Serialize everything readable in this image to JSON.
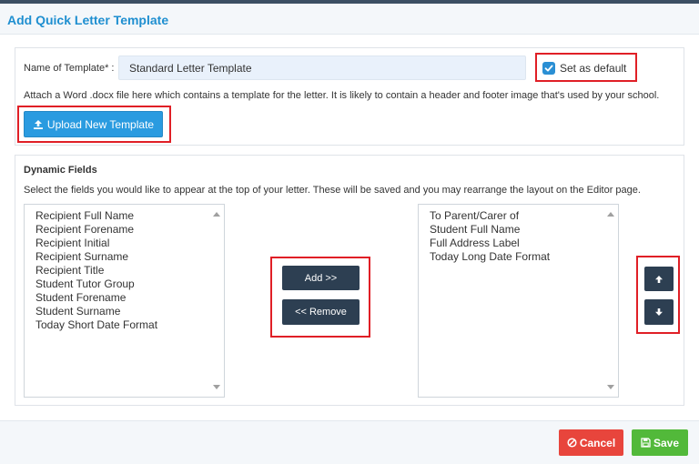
{
  "header": {
    "title": "Add Quick Letter Template"
  },
  "template": {
    "name_label": "Name of Template* :",
    "name_value": "Standard Letter Template",
    "default_label": "Set as default",
    "default_checked": true,
    "attach_text": "Attach a Word .docx file here which contains a template for the letter. It is likely to contain a header and footer image that's used by your school.",
    "upload_label": "Upload New Template"
  },
  "dynamic_fields": {
    "title": "Dynamic Fields",
    "description": "Select the fields you would like to appear at the top of your letter. These will be saved and you may rearrange the layout on the Editor page.",
    "available": [
      "Recipient Full Name",
      "Recipient Forename",
      "Recipient Initial",
      "Recipient Surname",
      "Recipient Title",
      "Student Tutor Group",
      "Student Forename",
      "Student Surname",
      "Today Short Date Format"
    ],
    "selected": [
      "To Parent/Carer of",
      "Student Full Name",
      "Full Address Label",
      "Today Long Date Format"
    ],
    "add_label": "Add >>",
    "remove_label": "<< Remove"
  },
  "footer": {
    "cancel_label": "Cancel",
    "save_label": "Save"
  },
  "colors": {
    "accent": "#1f8fd0",
    "upload": "#2a9be0",
    "dark_button": "#2d3f52",
    "cancel": "#e8453c",
    "save": "#52b93a",
    "highlight": "#e01f26"
  }
}
